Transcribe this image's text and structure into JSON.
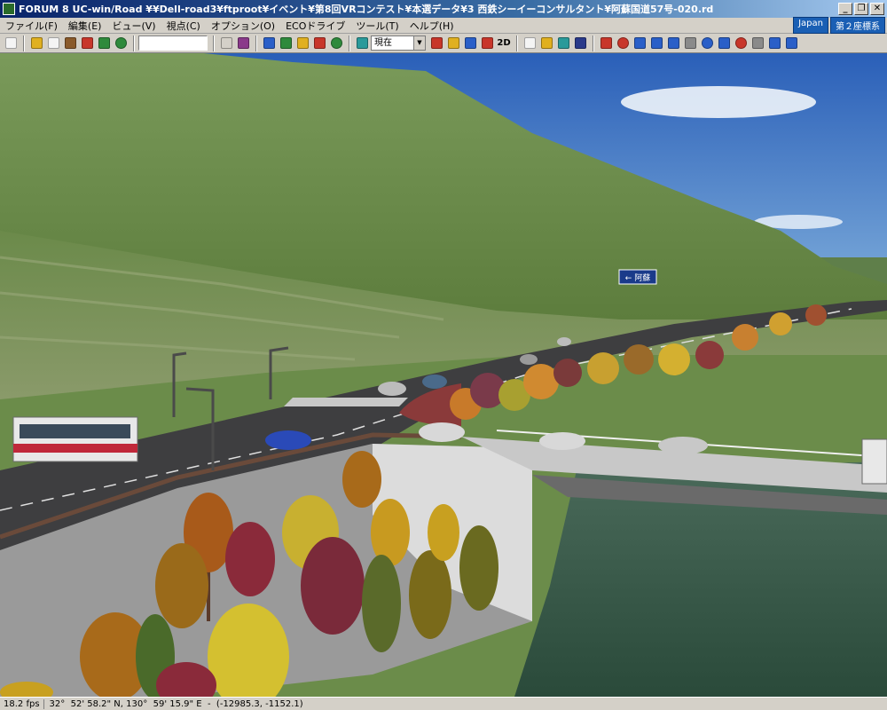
{
  "window": {
    "title": "FORUM 8    UC-win/Road    ¥¥Dell-road3¥ftproot¥イベント¥第8回VRコンテスト¥本選データ¥3 西鉄シーイーコンサルタント¥阿蘇国道57号-020.rd",
    "minimize": "_",
    "restore": "❐",
    "close": "✕"
  },
  "menu": {
    "items": [
      "ファイル(F)",
      "編集(E)",
      "ビュー(V)",
      "視点(C)",
      "オプション(O)",
      "ECOドライブ",
      "ツール(T)",
      "ヘルプ(H)"
    ],
    "locale_badge": "Japan",
    "coord_system_badge": "第２座標系"
  },
  "toolbar": {
    "time_select_value": "現在",
    "mode_2d_label": "2D",
    "colors": {
      "green": "#2f8a3c",
      "red": "#c8362a",
      "blue": "#2a5fc8",
      "yellow": "#e0b020",
      "gray": "#8a8a8a",
      "teal": "#2a9a9a",
      "white": "#f4f4f4",
      "brown": "#8a5a2a"
    }
  },
  "viewport": {
    "road_sign_text": "← 阿蘇"
  },
  "status": {
    "fps": "18.2 fps",
    "coordinates": "32°  52' 58.2\" N, 130°  59' 15.9\" E  -  (-12985.3, -1152.1)"
  }
}
